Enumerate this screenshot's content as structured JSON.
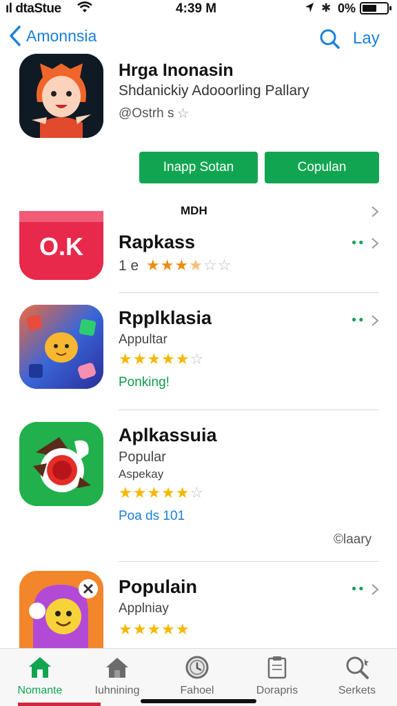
{
  "status_bar": {
    "carrier": "ıl dtaStue",
    "time": "4:39 M",
    "battery_pct": "0%"
  },
  "nav": {
    "back_label": "Amonnsia",
    "right_label": "Lay"
  },
  "featured": {
    "title": "Hrga Inonasin",
    "subtitle": "Shdanickiy Adooorling Pallary",
    "rating_text": "@Ostrh s",
    "button_a": "Inapp Sotan",
    "button_b": "Copulan"
  },
  "list": {
    "header": "MDH",
    "items": [
      {
        "name": "Rapkass",
        "line1": "1 e",
        "rating": 3.5,
        "icon_text": "O.K"
      },
      {
        "name": "Rpplklasia",
        "line1": "Appultar",
        "rating": 5,
        "line3": "Ponking!"
      },
      {
        "name": "Aplkassuia",
        "line1": "Popular",
        "line2": "Aspekay",
        "rating": 5,
        "line3": "Poa ds 101",
        "footnote": "©laary"
      },
      {
        "name": "Populain",
        "line1": "Applniay",
        "rating": 5
      }
    ]
  },
  "tabs": [
    {
      "label": "Nomante",
      "icon": "home-icon",
      "active": true
    },
    {
      "label": "Iuhnining",
      "icon": "house-icon",
      "active": false
    },
    {
      "label": "Fahoel",
      "icon": "clock-icon",
      "active": false
    },
    {
      "label": "Dorapris",
      "icon": "clipboard-icon",
      "active": false
    },
    {
      "label": "Serkets",
      "icon": "search-icon",
      "active": false
    }
  ],
  "colors": {
    "accent_blue": "#1a7fd6",
    "accent_green": "#12a551",
    "star_yellow": "#f5b800"
  }
}
